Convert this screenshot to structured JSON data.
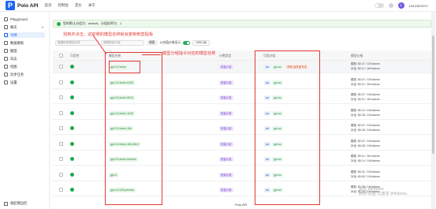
{
  "header": {
    "logo_letter": "P",
    "app_name": "Polo API",
    "nav": [
      "首页",
      "控制台",
      "定价",
      "关于"
    ],
    "avatar_letter": "1",
    "user_label": "15219873071"
  },
  "sidebar": {
    "items": [
      {
        "label": "Playground"
      },
      {
        "label": "聊天"
      },
      {
        "label": "令牌"
      },
      {
        "label": "数据看板"
      },
      {
        "label": "额度"
      },
      {
        "label": "日志"
      },
      {
        "label": "绘图"
      },
      {
        "label": "异步任务"
      },
      {
        "label": "设置"
      }
    ],
    "caret": "▾",
    "collapse_label": "收起侧边栏"
  },
  "banner": {
    "text": "您的默认分组为：default，分组倍率为：1"
  },
  "filters": {
    "search_placeholder": "模糊搜索模型名称",
    "second_placeholder": "模糊搜索分组",
    "search_button": "搜索",
    "toggle_label": "以充值价格显示",
    "currency": "USD ($)"
  },
  "table": {
    "headers": [
      "可用性",
      "模型名称",
      "计费类型",
      "可用分组",
      "模型价格"
    ],
    "rows": [
      {
        "model": "gpt-3.5-turbo",
        "type": "按量计费",
        "groups": [
          {
            "t": "a",
            "l": "aa"
          },
          {
            "t": "b",
            "l": "gpt-au"
          },
          {
            "t": "c",
            "l": "谨慎·高性能专线"
          }
        ],
        "price1": "模型: $0.07 / 1M tokens",
        "price2": "补全: $0.11 / 1M tokens"
      },
      {
        "model": "gpt-3.5-turbo-0125",
        "type": "按量计费",
        "groups": [
          {
            "t": "a",
            "l": "aa"
          },
          {
            "t": "b",
            "l": "gpt-au"
          }
        ],
        "price1": "模型: $0.07 / 1M tokens",
        "price2": "补全: $0.11 / 1M tokens"
      },
      {
        "model": "gpt-3.5-turbo-0613",
        "type": "按量计费",
        "groups": [
          {
            "t": "a",
            "l": "aa"
          },
          {
            "t": "b",
            "l": "gpt-au"
          }
        ],
        "price1": "模型: $0.07 / 1M tokens",
        "price2": "补全: $0.11 / 1M tokens"
      },
      {
        "model": "gpt-3.5-turbo-1106",
        "type": "按量计费",
        "groups": [
          {
            "t": "a",
            "l": "aa"
          },
          {
            "t": "b",
            "l": "gpt-au"
          }
        ],
        "price1": "模型: $0.14 / 1M tokens",
        "price2": "补全: $0.28 / 1M tokens"
      },
      {
        "model": "gpt-3.5-turbo-16k",
        "type": "按量计费",
        "groups": [
          {
            "t": "a",
            "l": "aa"
          },
          {
            "t": "b",
            "l": "gpt-au"
          }
        ],
        "price1": "模型: $0.07 / 1M tokens",
        "price2": "补全: $0.28 / 1M tokens"
      },
      {
        "model": "gpt-3.5-turbo-16k-0613",
        "type": "按量计费",
        "groups": [
          {
            "t": "a",
            "l": "aa"
          },
          {
            "t": "b",
            "l": "gpt-au"
          }
        ],
        "price1": "模型: $0.07 / 1M tokens",
        "price2": "补全: $0.28 / 1M tokens"
      },
      {
        "model": "gpt-3.5-turbo-instruct",
        "type": "按量计费",
        "groups": [
          {
            "t": "a",
            "l": "aa"
          },
          {
            "t": "b",
            "l": "gpt-au"
          }
        ],
        "price1": "模型: $0.11 / 1M tokens",
        "price2": "补全: $0.14 / 1M tokens"
      },
      {
        "model": "gpt-4",
        "type": "按量计费",
        "groups": [
          {
            "t": "a",
            "l": "aa"
          },
          {
            "t": "b",
            "l": "gpt-au"
          }
        ],
        "price1": "模型: $0.41 / 1M tokens",
        "price2": "补全: $0.83 / 1M tokens"
      },
      {
        "model": "gpt-4-0125-preview",
        "type": "按量计费",
        "groups": [
          {
            "t": "a",
            "l": "aa"
          },
          {
            "t": "b",
            "l": "gpt-au"
          }
        ],
        "price1": "模型: $1.38 / 1M tokens",
        "price2": "补全: $1.20 / 1M tokens"
      }
    ]
  },
  "annotations": {
    "model_note": "找到并点击，这时候的模型名称就会复制到剪贴板",
    "group_note": "模型分组指令对应的模型名称"
  },
  "footer": {
    "text": "Polo API"
  },
  "watermark": {
    "line1": "激活 Windows",
    "line2": "转到\"设置\"以激活 Windows。"
  },
  "colors": {
    "accent": "#1e66f5",
    "success": "#20a84a",
    "annotation": "#e53935"
  }
}
